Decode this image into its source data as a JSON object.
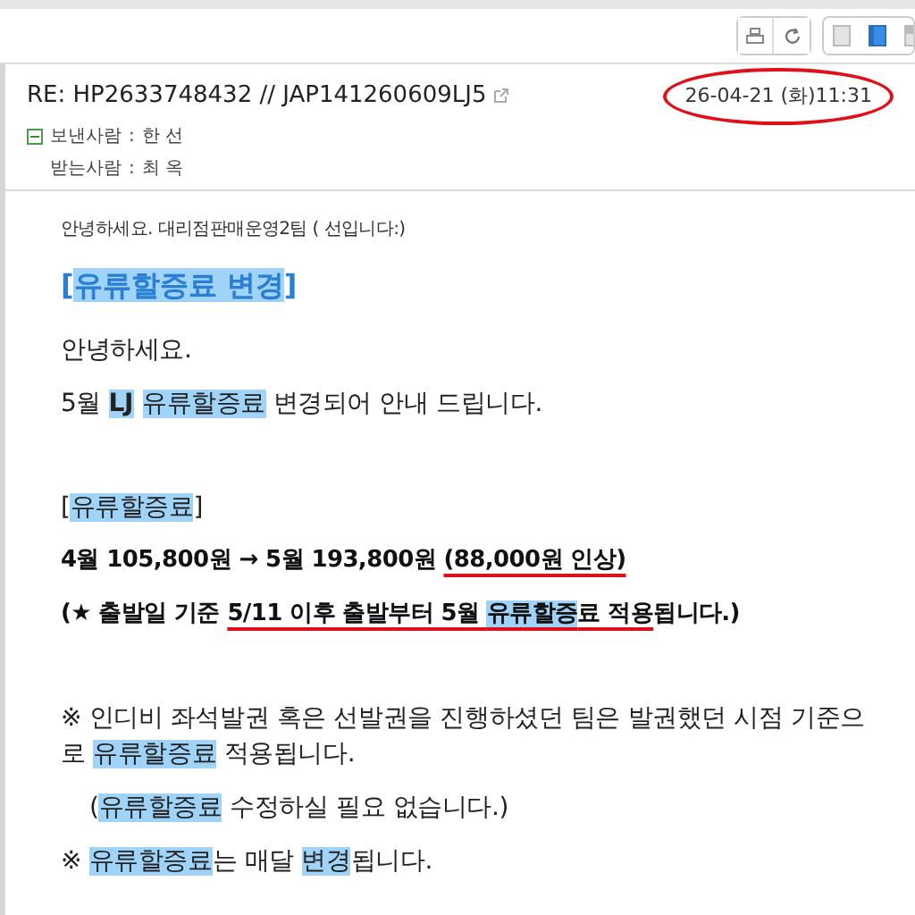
{
  "toolbar": {
    "actions": [
      {
        "kind": "print"
      },
      {
        "kind": "refresh"
      }
    ],
    "views": [
      {
        "kind": "plain",
        "selected": false
      },
      {
        "kind": "split",
        "selected": true
      },
      {
        "kind": "rows",
        "selected": false
      }
    ]
  },
  "mail": {
    "subject": "RE: HP2633748432 // JAP141260609LJ5",
    "date": "26-04-21 (화)11:31",
    "date_circled": true,
    "expanded": true,
    "sender_label": "보낸사람",
    "sender_sep": ":",
    "sender": "한 선",
    "recipient_label": "받는사람",
    "recipient_sep": ":",
    "recipient": "최 옥"
  },
  "paragraphs": [
    {
      "kind": "small",
      "segments": [
        {
          "text": "안녕하세요. 대리점판매운영2팀 ( 선입니다:)"
        }
      ]
    },
    {
      "kind": "heading",
      "segments": [
        {
          "text": "["
        },
        {
          "text": "유류할증료 변경",
          "hl": true
        },
        {
          "text": "]"
        }
      ]
    },
    {
      "kind": "body",
      "segments": [
        {
          "text": "안녕하세요."
        }
      ]
    },
    {
      "kind": "body",
      "segments": [
        {
          "text": "5월 "
        },
        {
          "text": "LJ",
          "hl": true,
          "b": true
        },
        {
          "text": "유류할증료",
          "hl": true,
          "space_before": true
        },
        {
          "text": " 변경되어 안내 드립니다."
        }
      ]
    },
    {
      "kind": "gap"
    },
    {
      "kind": "body",
      "segments": [
        {
          "text": "["
        },
        {
          "text": "유류할증료",
          "hl": true
        },
        {
          "text": "]"
        }
      ]
    },
    {
      "kind": "bold",
      "segments": [
        {
          "text": "4월 105,800원 → 5월 193,800원 "
        },
        {
          "text": "(88,000원 인상)",
          "ul": true
        }
      ]
    },
    {
      "kind": "bold",
      "segments": [
        {
          "text": "(★ 출발일 기준 "
        },
        {
          "text": "5/11 이후 출발부터 5월 ",
          "ul": true
        },
        {
          "text": "유류할증",
          "ul": true,
          "hl": true
        },
        {
          "text": "료 적용",
          "ul": true
        },
        {
          "text": "됩니다.)"
        }
      ]
    },
    {
      "kind": "gap"
    },
    {
      "kind": "body",
      "segments": [
        {
          "text": "※ 인디비 좌석발권 혹은 선발권을 진행하셨던 팀은 발권했던 시점 기준으로 "
        },
        {
          "text": "유류할증료",
          "hl": true
        },
        {
          "text": " 적용됩니다."
        }
      ]
    },
    {
      "kind": "indent",
      "segments": [
        {
          "text": "("
        },
        {
          "text": "유류할증료",
          "hl": true
        },
        {
          "text": " 수정하실 필요 없습니다.)"
        }
      ]
    },
    {
      "kind": "body",
      "segments": [
        {
          "text": "※ "
        },
        {
          "text": "유류할증료",
          "hl": true
        },
        {
          "text": "는 매달 "
        },
        {
          "text": "변경",
          "hl": true
        },
        {
          "text": "됩니다."
        }
      ]
    }
  ]
}
